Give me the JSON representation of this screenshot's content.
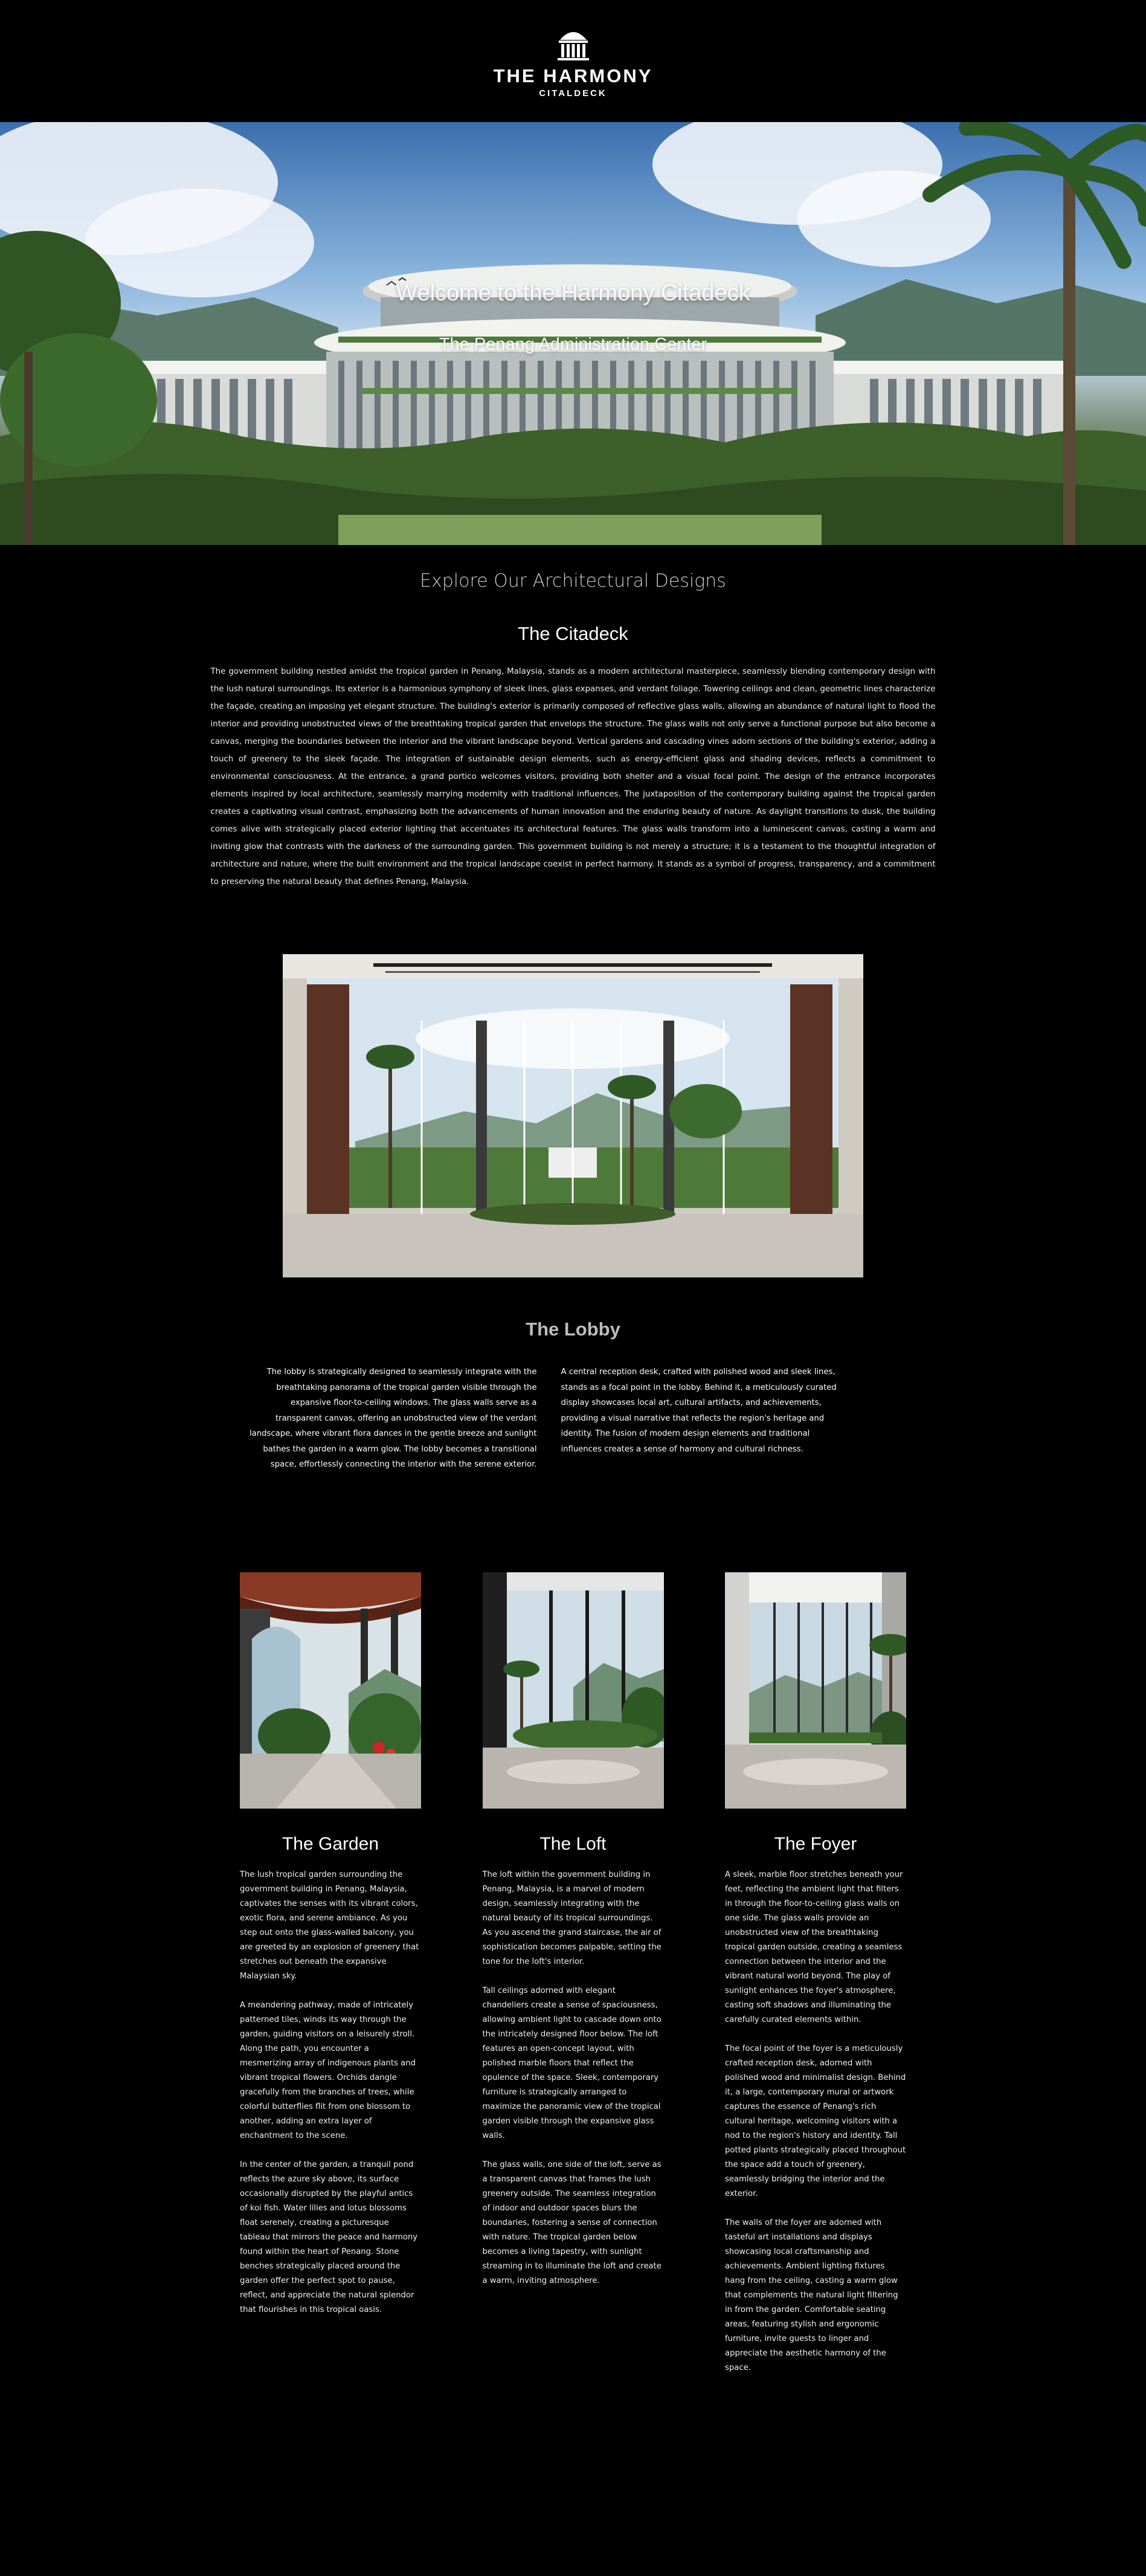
{
  "header": {
    "brand_name": "THE HARMONY",
    "brand_sub": "CITALDECK",
    "logo_icon": "dome-building-icon"
  },
  "hero": {
    "title": "Welcome to the Harmony Citadeck",
    "subtitle": "The Penang Administration Center"
  },
  "explore_heading": "Explore Our Architectural Designs",
  "citadeck": {
    "title": "The Citadeck",
    "body": "The government building nestled amidst the tropical garden in Penang, Malaysia, stands as a modern architectural masterpiece, seamlessly blending contemporary design with the lush natural surroundings. Its exterior is a harmonious symphony of sleek lines, glass expanses, and verdant foliage. Towering ceilings and clean, geometric lines characterize the façade, creating an imposing yet elegant structure. The building's exterior is primarily composed of reflective glass walls, allowing an abundance of natural light to flood the interior and providing unobstructed views of the breathtaking tropical garden that envelops the structure. The glass walls not only serve a functional purpose but also become a canvas, merging the boundaries between the interior and the vibrant landscape beyond. Vertical gardens and cascading vines adorn sections of the building's exterior, adding a touch of greenery to the sleek façade. The integration of sustainable design elements, such as energy-efficient glass and shading devices, reflects a commitment to environmental consciousness. At the entrance, a grand portico welcomes visitors, providing both shelter and a visual focal point. The design of the entrance incorporates elements inspired by local architecture, seamlessly marrying modernity with traditional influences. The juxtaposition of the contemporary building against the tropical garden creates a captivating visual contrast, emphasizing both the advancements of human innovation and the enduring beauty of nature. As daylight transitions to dusk, the building comes alive with strategically placed exterior lighting that accentuates its architectural features. The glass walls transform into a luminescent canvas, casting a warm and inviting glow that contrasts with the darkness of the surrounding garden. This government building is not merely a structure; it is a testament to the thoughtful integration of architecture and nature, where the built environment and the tropical landscape coexist in perfect harmony. It stands as a symbol of progress, transparency, and a commitment to preserving the natural beauty that defines Penang, Malaysia."
  },
  "lobby": {
    "title": "The Lobby",
    "left_text": "The lobby is strategically designed to seamlessly integrate with the breathtaking panorama of the tropical garden visible through the expansive floor-to-ceiling windows. The glass walls serve as a transparent canvas, offering an unobstructed view of the verdant landscape, where vibrant flora dances in the gentle breeze and sunlight bathes the garden in a warm glow. The lobby becomes a transitional space, effortlessly connecting the interior with the serene exterior.",
    "right_text": "A central reception desk, crafted with polished wood and sleek lines, stands as a focal point in the lobby. Behind it, a meticulously curated display showcases local art, cultural artifacts, and achievements, providing a visual narrative that reflects the region's heritage and identity. The fusion of modern design elements and traditional influences creates a sense of harmony and cultural richness."
  },
  "rooms": [
    {
      "title": "The Garden",
      "paragraphs": [
        "The lush tropical garden surrounding the government building in Penang, Malaysia, captivates the senses with its vibrant colors, exotic flora, and serene ambiance. As you step out onto the glass-walled balcony, you are greeted by an explosion of greenery that stretches out beneath the expansive Malaysian sky.",
        "A meandering pathway, made of intricately patterned tiles, winds its way through the garden, guiding visitors on a leisurely stroll. Along the path, you encounter a mesmerizing array of indigenous plants and vibrant tropical flowers. Orchids dangle gracefully from the branches of trees, while colorful butterflies flit from one blossom to another, adding an extra layer of enchantment to the scene.",
        "In the center of the garden, a tranquil pond reflects the azure sky above, its surface occasionally disrupted by the playful antics of koi fish. Water lilies and lotus blossoms float serenely, creating a picturesque tableau that mirrors the peace and harmony found within the heart of Penang. Stone benches strategically placed around the garden offer the perfect spot to pause, reflect, and appreciate the natural splendor that flourishes in this tropical oasis."
      ]
    },
    {
      "title": "The Loft",
      "paragraphs": [
        "The loft within the government building in Penang, Malaysia, is a marvel of modern design, seamlessly integrating with the natural beauty of its tropical surroundings. As you ascend the grand staircase, the air of sophistication becomes palpable, setting the tone for the loft's interior.",
        "Tall ceilings adorned with elegant chandeliers create a sense of spaciousness, allowing ambient light to cascade down onto the intricately designed floor below. The loft features an open-concept layout, with polished marble floors that reflect the opulence of the space. Sleek, contemporary furniture is strategically arranged to maximize the panoramic view of the tropical garden visible through the expansive glass walls.",
        "The glass walls, one side of the loft, serve as a transparent canvas that frames the lush greenery outside. The seamless integration of indoor and outdoor spaces blurs the boundaries, fostering a sense of connection with nature. The tropical garden below becomes a living tapestry, with sunlight streaming in to illuminate the loft and create a warm, inviting atmosphere."
      ]
    },
    {
      "title": "The Foyer",
      "paragraphs": [
        "A sleek, marble floor stretches beneath your feet, reflecting the ambient light that filters in through the floor-to-ceiling glass walls on one side. The glass walls provide an unobstructed view of the breathtaking tropical garden outside, creating a seamless connection between the interior and the vibrant natural world beyond. The play of sunlight enhances the foyer's atmosphere, casting soft shadows and illuminating the carefully curated elements within.",
        "The focal point of the foyer is a meticulously crafted reception desk, adorned with polished wood and minimalist design. Behind it, a large, contemporary mural or artwork captures the essence of Penang's rich cultural heritage, welcoming visitors with a nod to the region's history and identity. Tall potted plants strategically placed throughout the space add a touch of greenery, seamlessly bridging the interior and the exterior.",
        "The walls of the foyer are adorned with tasteful art installations and displays showcasing local craftsmanship and achievements. Ambient lighting fixtures hang from the ceiling, casting a warm glow that complements the natural light filtering in from the garden. Comfortable seating areas, featuring stylish and ergonomic furniture, invite guests to linger and appreciate the aesthetic harmony of the space."
      ]
    }
  ]
}
